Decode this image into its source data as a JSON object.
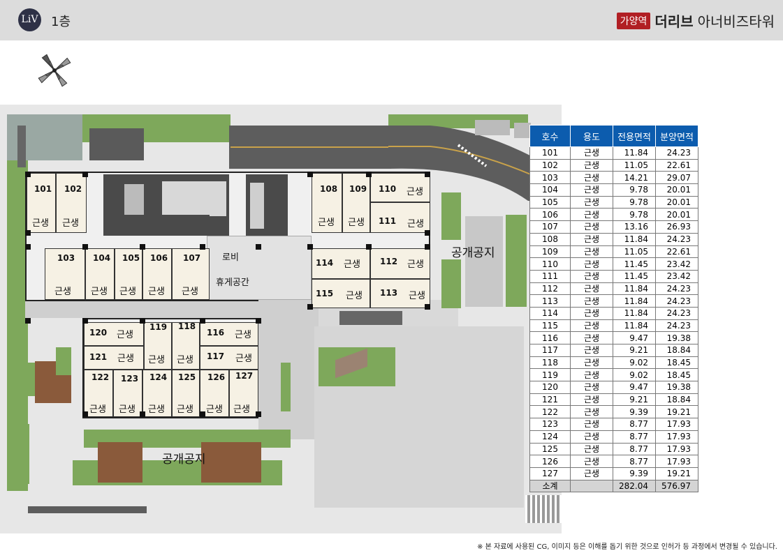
{
  "header": {
    "logo_text": "LiV",
    "floor": "1층",
    "brand_badge": "가양역",
    "brand_name": "더리브",
    "brand_sub": "아너비즈타워",
    "accent": "#b11f24"
  },
  "plan": {
    "lobby": "로비",
    "rest": "휴게공간",
    "public_space_right": "공개공지",
    "public_space_bottom": "공개공지",
    "units": [
      {
        "no": "101",
        "use": "근생"
      },
      {
        "no": "102",
        "use": "근생"
      },
      {
        "no": "103",
        "use": "근생"
      },
      {
        "no": "104",
        "use": "근생"
      },
      {
        "no": "105",
        "use": "근생"
      },
      {
        "no": "106",
        "use": "근생"
      },
      {
        "no": "107",
        "use": "근생"
      },
      {
        "no": "108",
        "use": "근생"
      },
      {
        "no": "109",
        "use": "근생"
      },
      {
        "no": "110",
        "use": "근생"
      },
      {
        "no": "111",
        "use": "근생"
      },
      {
        "no": "112",
        "use": "근생"
      },
      {
        "no": "113",
        "use": "근생"
      },
      {
        "no": "114",
        "use": "근생"
      },
      {
        "no": "115",
        "use": "근생"
      },
      {
        "no": "116",
        "use": "근생"
      },
      {
        "no": "117",
        "use": "근생"
      },
      {
        "no": "118",
        "use": "근생"
      },
      {
        "no": "119",
        "use": "근생"
      },
      {
        "no": "120",
        "use": "근생"
      },
      {
        "no": "121",
        "use": "근생"
      },
      {
        "no": "122",
        "use": "근생"
      },
      {
        "no": "123",
        "use": "근생"
      },
      {
        "no": "124",
        "use": "근생"
      },
      {
        "no": "125",
        "use": "근생"
      },
      {
        "no": "126",
        "use": "근생"
      },
      {
        "no": "127",
        "use": "근생"
      }
    ]
  },
  "table": {
    "headers": [
      "호수",
      "용도",
      "전용면적",
      "분양면적"
    ],
    "header_color": "#0c5cae",
    "rows": [
      [
        "101",
        "근생",
        "11.84",
        "24.23"
      ],
      [
        "102",
        "근생",
        "11.05",
        "22.61"
      ],
      [
        "103",
        "근생",
        "14.21",
        "29.07"
      ],
      [
        "104",
        "근생",
        "9.78",
        "20.01"
      ],
      [
        "105",
        "근생",
        "9.78",
        "20.01"
      ],
      [
        "106",
        "근생",
        "9.78",
        "20.01"
      ],
      [
        "107",
        "근생",
        "13.16",
        "26.93"
      ],
      [
        "108",
        "근생",
        "11.84",
        "24.23"
      ],
      [
        "109",
        "근생",
        "11.05",
        "22.61"
      ],
      [
        "110",
        "근생",
        "11.45",
        "23.42"
      ],
      [
        "111",
        "근생",
        "11.45",
        "23.42"
      ],
      [
        "112",
        "근생",
        "11.84",
        "24.23"
      ],
      [
        "113",
        "근생",
        "11.84",
        "24.23"
      ],
      [
        "114",
        "근생",
        "11.84",
        "24.23"
      ],
      [
        "115",
        "근생",
        "11.84",
        "24.23"
      ],
      [
        "116",
        "근생",
        "9.47",
        "19.38"
      ],
      [
        "117",
        "근생",
        "9.21",
        "18.84"
      ],
      [
        "118",
        "근생",
        "9.02",
        "18.45"
      ],
      [
        "119",
        "근생",
        "9.02",
        "18.45"
      ],
      [
        "120",
        "근생",
        "9.47",
        "19.38"
      ],
      [
        "121",
        "근생",
        "9.21",
        "18.84"
      ],
      [
        "122",
        "근생",
        "9.39",
        "19.21"
      ],
      [
        "123",
        "근생",
        "8.77",
        "17.93"
      ],
      [
        "124",
        "근생",
        "8.77",
        "17.93"
      ],
      [
        "125",
        "근생",
        "8.77",
        "17.93"
      ],
      [
        "126",
        "근생",
        "8.77",
        "17.93"
      ],
      [
        "127",
        "근생",
        "9.39",
        "19.21"
      ]
    ],
    "total": [
      "소계",
      "",
      "282.04",
      "576.97"
    ]
  },
  "footnote": "※ 본 자료에 사용된 CG, 이미지 등은 이해를 돕기 위한 것으로 인허가 등 과정에서 변경될 수 있습니다."
}
